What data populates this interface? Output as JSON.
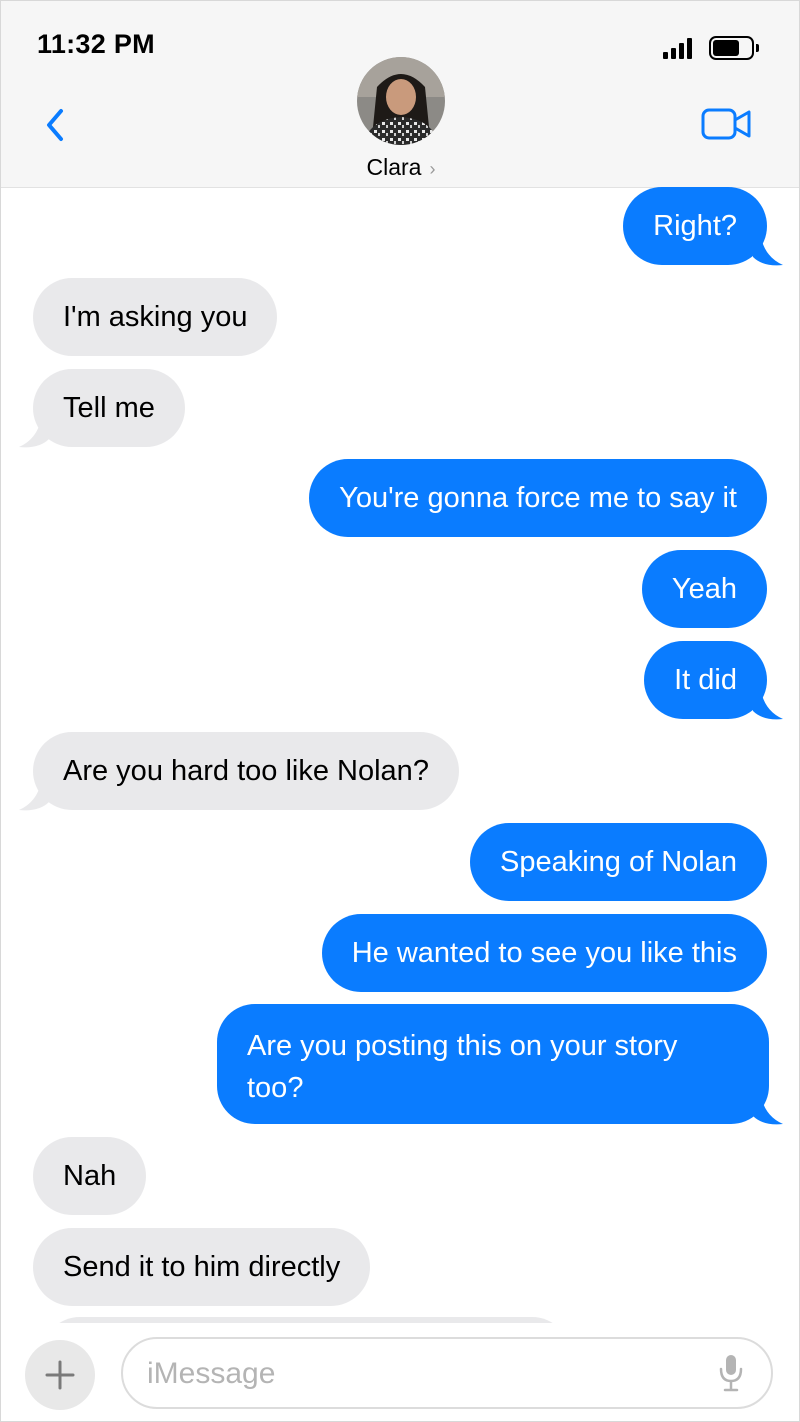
{
  "status_bar": {
    "time": "11:32 PM"
  },
  "contact": {
    "name": "Clara",
    "chevron": "›"
  },
  "icons": {
    "back": "chevron-left-icon",
    "video": "video-camera-icon",
    "plus": "plus-icon",
    "mic": "microphone-icon",
    "signal": "cellular-signal-icon",
    "battery": "battery-icon"
  },
  "colors": {
    "accent": "#0a7cff",
    "received_bubble": "#e9e9eb",
    "header_bg": "#f6f6f6"
  },
  "messages": [
    {
      "direction": "sent",
      "text": "Right?"
    },
    {
      "direction": "received",
      "text": "I'm asking you"
    },
    {
      "direction": "received",
      "text": "Tell me"
    },
    {
      "direction": "sent",
      "text": "You're gonna force me to say it"
    },
    {
      "direction": "sent",
      "text": "Yeah"
    },
    {
      "direction": "sent",
      "text": "It did"
    },
    {
      "direction": "received",
      "text": "Are you hard too like Nolan?"
    },
    {
      "direction": "sent",
      "text": "Speaking of Nolan"
    },
    {
      "direction": "sent",
      "text": "He wanted to see you like this"
    },
    {
      "direction": "sent",
      "text": "Are you posting this on your story too?"
    },
    {
      "direction": "received",
      "text": "Nah"
    },
    {
      "direction": "received",
      "text": "Send it to him directly"
    }
  ],
  "composer": {
    "placeholder": "iMessage"
  }
}
